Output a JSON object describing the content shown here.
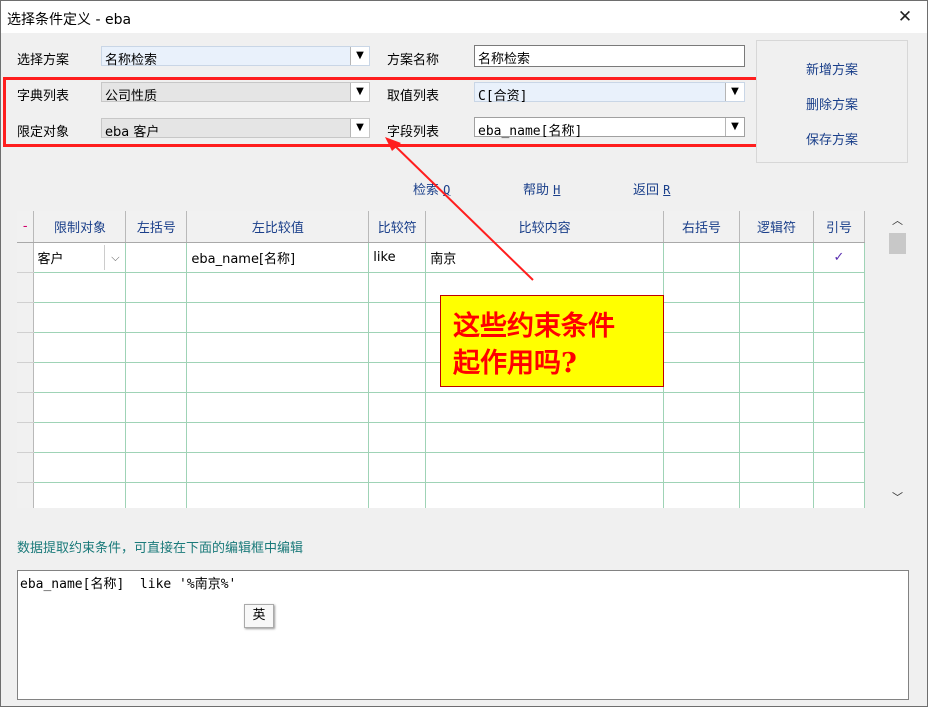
{
  "window": {
    "title": "选择条件定义 - eba",
    "close_glyph": "✕"
  },
  "form": {
    "scheme_label": "选择方案",
    "scheme_value": "名称检索",
    "scheme_name_label": "方案名称",
    "scheme_name_value": "名称检索",
    "dict_label": "字典列表",
    "dict_value": "公司性质",
    "value_label": "取值列表",
    "value_value": "C[合资]",
    "target_label": "限定对象",
    "target_value": "eba 客户",
    "field_label": "字段列表",
    "field_value": "eba_name[名称]"
  },
  "side_buttons": {
    "add": "新增方案",
    "delete": "删除方案",
    "save": "保存方案"
  },
  "actions": {
    "search": "检索",
    "search_key": "Q",
    "help": "帮助",
    "help_key": "H",
    "back": "返回",
    "back_key": "R"
  },
  "grid": {
    "marker_header": "-",
    "headers": [
      "限制对象",
      "左括号",
      "左比较值",
      "比较符",
      "比较内容",
      "右括号",
      "逻辑符",
      "引号"
    ],
    "rows": [
      {
        "object": "客户",
        "lparen": "",
        "left": "eba_name[名称]",
        "op": "like",
        "content": "南京",
        "rparen": "",
        "logic": "",
        "quote": "✓"
      }
    ],
    "empty_rows": 8
  },
  "hint": "数据提取约束条件，可直接在下面的编辑框中编辑",
  "editor": {
    "text": "eba_name[名称]  like '%南京%'"
  },
  "ime": "英",
  "callout": {
    "line1": "这些约束条件",
    "line2": "起作用吗?"
  },
  "colors": {
    "highlight_box": "#ff1e1e",
    "callout_bg": "#ffff00",
    "callout_text": "#ff0000",
    "link": "#1a3f8a"
  }
}
